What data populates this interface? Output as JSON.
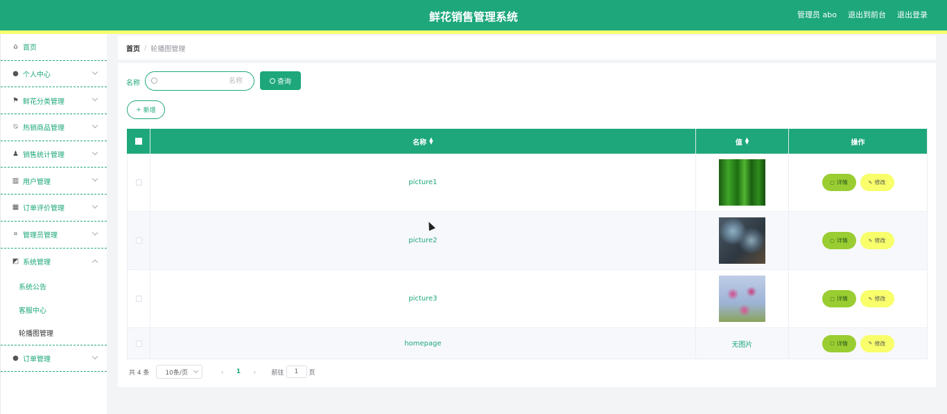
{
  "header": {
    "title": "鲜花销售管理系统",
    "admin_label": "管理员 abo",
    "front_label": "退出到前台",
    "logout_label": "退出登录"
  },
  "sidebar": {
    "items": [
      {
        "label": "首页",
        "icon": "home-icon"
      },
      {
        "label": "个人中心",
        "icon": "user-icon"
      },
      {
        "label": "鲜花分类管理",
        "icon": "flag-icon"
      },
      {
        "label": "热销商品管理",
        "icon": "bell-off-icon"
      },
      {
        "label": "销售统计管理",
        "icon": "person-icon"
      },
      {
        "label": "用户管理",
        "icon": "bar-chart-icon"
      },
      {
        "label": "订单评价管理",
        "icon": "grid-icon"
      },
      {
        "label": "管理员管理",
        "icon": "crop-icon"
      },
      {
        "label": "系统管理",
        "icon": "chart-icon"
      },
      {
        "label": "订单管理",
        "icon": "location-icon"
      }
    ],
    "submenu": [
      "系统公告",
      "客服中心",
      "轮播图管理"
    ]
  },
  "breadcrumb": {
    "home": "首页",
    "sep": "/",
    "current": "轮播图管理"
  },
  "search": {
    "label": "名称",
    "placeholder": "名称",
    "query_label": "查询",
    "add_label": "新增"
  },
  "table": {
    "columns": [
      "名称",
      "值",
      "操作"
    ],
    "rows": [
      {
        "name": "picture1"
      },
      {
        "name": "picture2"
      },
      {
        "name": "picture3"
      },
      {
        "name": "homepage",
        "value": "无图片"
      }
    ],
    "detail_label": "详情",
    "edit_label": "修改"
  },
  "pagination": {
    "total": "共 4 条",
    "page_size": "10条/页",
    "current": "1",
    "goto": "前往",
    "page_input": "1",
    "page_suffix": "页"
  }
}
